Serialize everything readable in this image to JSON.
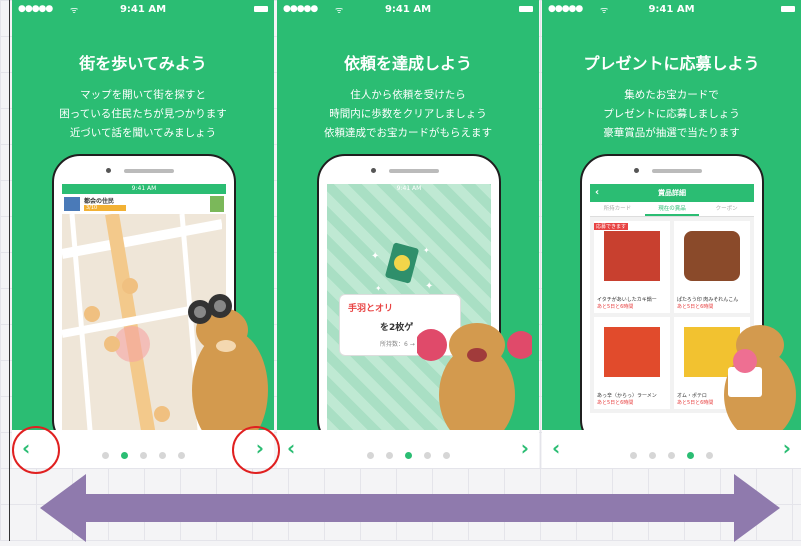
{
  "statusbar": {
    "time": "9:41 AM",
    "dots": "●●●●●",
    "wifi": "ᯤ"
  },
  "panels": [
    {
      "title": "街を歩いてみよう",
      "desc": [
        "マップを開いて街を探すと",
        "困っている住民たちが見つかります",
        "近づいて話を聞いてみましょう"
      ],
      "active_dot": 1
    },
    {
      "title": "依頼を達成しよう",
      "desc": [
        "住人から依頼を受けたら",
        "時間内に歩数をクリアしましょう",
        "依頼達成でお宝カードがもらえます"
      ],
      "active_dot": 2
    },
    {
      "title": "プレゼントに応募しよう",
      "desc": [
        "集めたお宝カードで",
        "プレゼントに応募しましょう",
        "豪華賞品が抽選で当たります"
      ],
      "active_dot": 3
    }
  ],
  "screen1": {
    "mini_time": "9:41 AM",
    "resident_label": "都会の住民",
    "progress_text": "3/10"
  },
  "screen2": {
    "mini_time": "9:41 AM",
    "request_title": "手羽とオリ",
    "request_count": "を2枚ゲ",
    "request_time": "所持数：6 → 8"
  },
  "screen3": {
    "header": "賞品詳細",
    "tabs": [
      "所持カード",
      "現在の賞品",
      "クーポン"
    ],
    "active_tab": 1,
    "prizes": [
      {
        "caption": "イタチがあいしたカキ鍋ー",
        "sub": "あと5日と6時間",
        "tag": "応募できます"
      },
      {
        "caption": "ぱたろう印 肉みそれんこん",
        "sub": "あと5日と6時間",
        "tag": ""
      },
      {
        "caption": "あっ辛（からっ）ラーメン",
        "sub": "あと5日と6時間",
        "tag": ""
      },
      {
        "caption": "オム・ポテロ",
        "sub": "あと5日と6時間",
        "tag": ""
      }
    ]
  },
  "nav": {
    "prev": "‹",
    "next": "›",
    "dot_count": 5
  },
  "colors": {
    "brand": "#2bbd73",
    "highlight_circle": "#e02020",
    "arrow": "#8f7aad"
  }
}
